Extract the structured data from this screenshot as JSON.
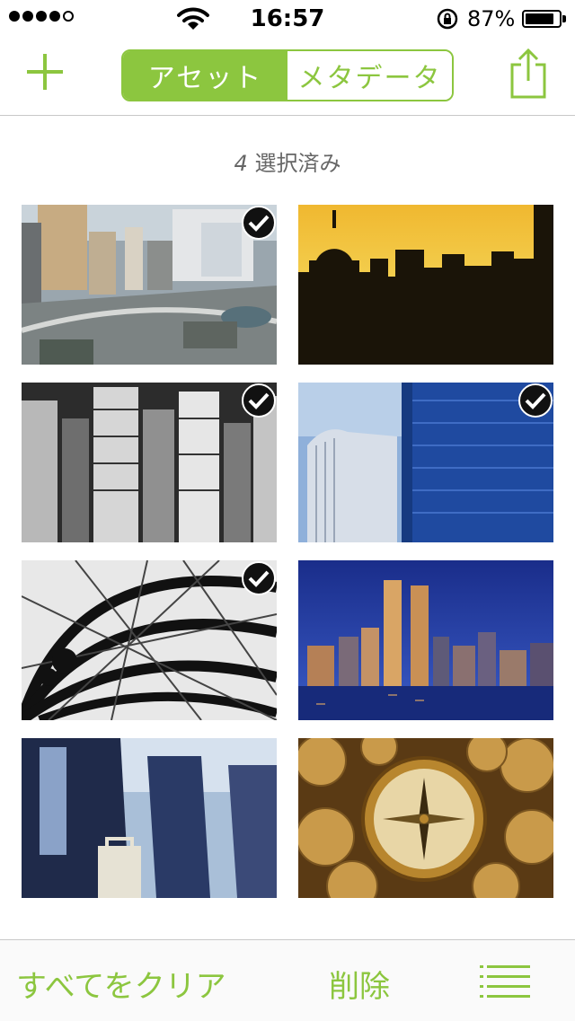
{
  "status_bar": {
    "time": "16:57",
    "battery_percent": "87%",
    "battery_level": 0.87,
    "signal_bars_filled": 4,
    "signal_bars_total": 5
  },
  "nav": {
    "segments": [
      "アセット",
      "メタデータ"
    ],
    "active_segment": 0,
    "add_icon": "plus-icon",
    "share_icon": "share-icon"
  },
  "selection": {
    "count": "4",
    "label": "選択済み"
  },
  "assets": [
    {
      "subject": "aerial city intersection",
      "selected": true
    },
    {
      "subject": "dome skyline silhouette at sunset",
      "selected": false
    },
    {
      "subject": "black and white skyscrapers",
      "selected": true
    },
    {
      "subject": "blue glass office towers",
      "selected": true
    },
    {
      "subject": "steel arch roof structure",
      "selected": true
    },
    {
      "subject": "night skyline twin towers",
      "selected": false
    },
    {
      "subject": "business people walking",
      "selected": false
    },
    {
      "subject": "compass on coins",
      "selected": false
    }
  ],
  "toolbar": {
    "clear_all": "すべてをクリア",
    "delete": "削除",
    "list_icon": "list-icon"
  },
  "colors": {
    "accent": "#8cc63f",
    "selection_text": "#666666",
    "divider": "#c8c8c8"
  }
}
